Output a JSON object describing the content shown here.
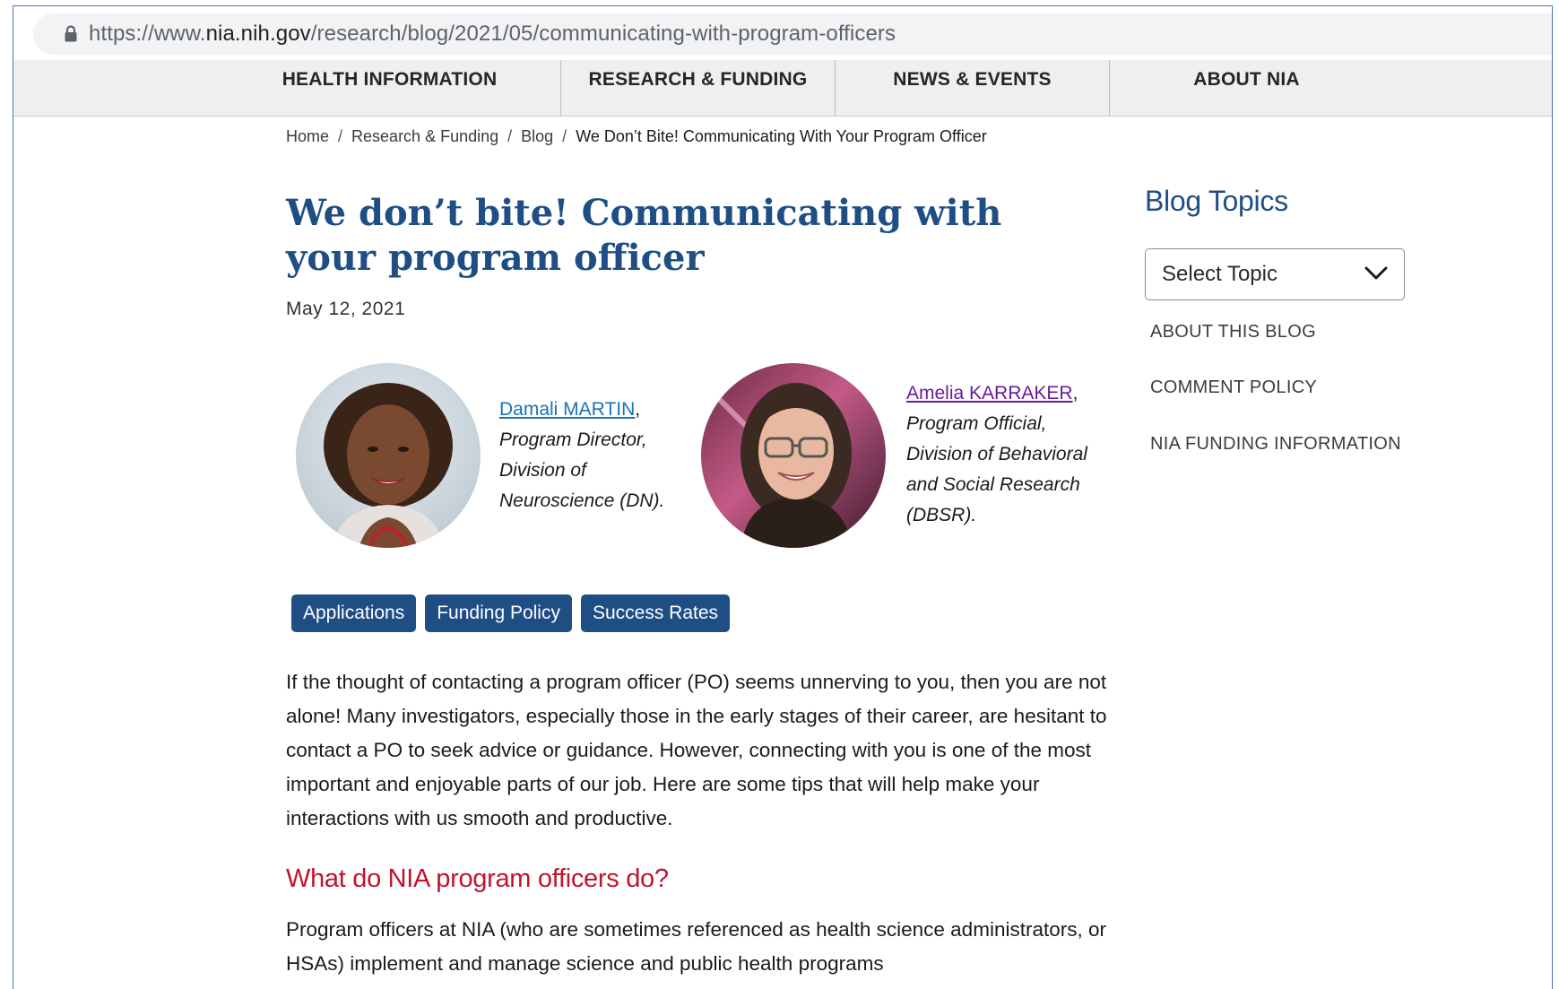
{
  "browser": {
    "url_scheme_host_prefix": "https://www.",
    "url_host": "nia.nih.gov",
    "url_path": "/research/blog/2021/05/communicating-with-program-officers"
  },
  "nav": {
    "items": [
      {
        "label": "HEALTH INFORMATION"
      },
      {
        "label": "RESEARCH & FUNDING"
      },
      {
        "label": "NEWS & EVENTS"
      },
      {
        "label": "ABOUT NIA"
      }
    ]
  },
  "breadcrumb": {
    "items": [
      "Home",
      "Research & Funding",
      "Blog"
    ],
    "separator": "/",
    "current": "We Don’t Bite! Communicating With Your Program Officer"
  },
  "article": {
    "title": "We don’t bite! Communicating with your program officer",
    "date": "May 12, 2021",
    "authors": [
      {
        "name": "Damali MARTIN",
        "suffix": ",",
        "role_lines": [
          "Program Director,",
          "Division of",
          "Neuroscience (DN)."
        ]
      },
      {
        "name": "Amelia KARRAKER",
        "suffix": ",",
        "role_lines": [
          "Program Official,",
          "Division of Behavioral",
          "and Social Research",
          "(DBSR)."
        ]
      }
    ],
    "tags": [
      "Applications",
      "Funding Policy",
      "Success Rates"
    ],
    "intro": "If the thought of contacting a program officer (PO) seems unnerving to you, then you are not alone! Many investigators, especially those in the early stages of their career, are hesitant to contact a PO to seek advice or guidance. However, connecting with you is one of the most important and enjoyable parts of our job. Here are some tips that will help make your interactions with us smooth and productive.",
    "section_heading": "What do NIA program officers do?",
    "section_body": "Program officers at NIA (who are sometimes referenced as health science administrators, or HSAs) implement and manage science and public health programs"
  },
  "sidebar": {
    "title": "Blog Topics",
    "select_label": "Select Topic",
    "links": [
      "ABOUT THIS BLOG",
      "COMMENT POLICY",
      "NIA FUNDING INFORMATION"
    ]
  },
  "colors": {
    "brand_blue": "#1f4e85",
    "heading_red": "#c0142d",
    "link_blue": "#1a73b8",
    "visited_purple": "#6a1b9a"
  }
}
